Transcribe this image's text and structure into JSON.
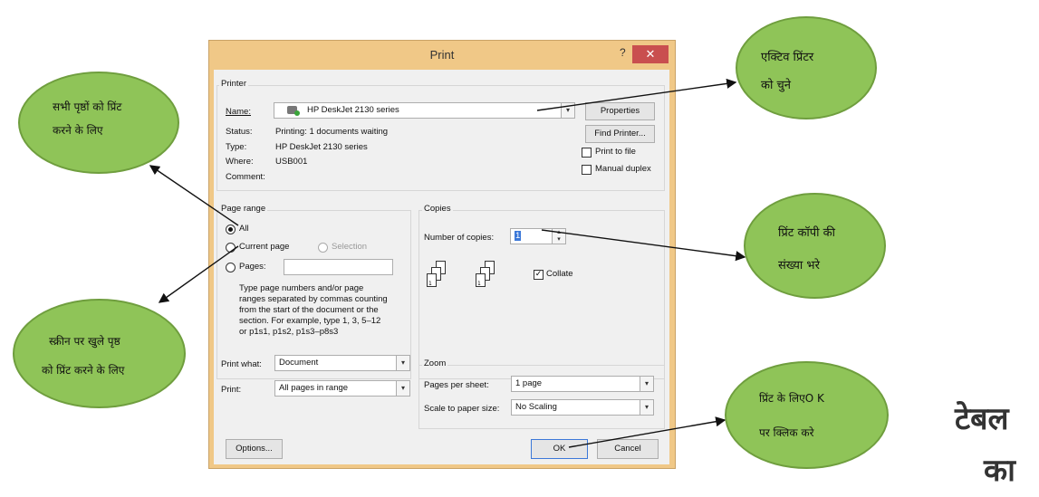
{
  "dialog": {
    "title": "Print",
    "help": "?",
    "close": "✕",
    "printer_group": "Printer",
    "name_label": "Name:",
    "printer_name": "HP DeskJet 2130 series",
    "properties": "Properties",
    "find_printer": "Find Printer...",
    "print_to_file": "Print to file",
    "manual_duplex": "Manual duplex",
    "status_label": "Status:",
    "status_value": "Printing: 1 documents waiting",
    "type_label": "Type:",
    "type_value": "HP DeskJet 2130 series",
    "where_label": "Where:",
    "where_value": "USB001",
    "comment_label": "Comment:",
    "page_range_group": "Page range",
    "all": "All",
    "current_page": "Current page",
    "selection": "Selection",
    "pages": "Pages:",
    "pages_help": [
      "Type page numbers and/or page",
      "ranges separated by commas counting",
      "from the start of the document or the",
      "section. For example, type 1, 3, 5–12",
      "or p1s1, p1s2, p1s3–p8s3"
    ],
    "copies_group": "Copies",
    "number_of_copies_label": "Number of copies:",
    "copies_value": "1",
    "collate": "Collate",
    "print_what_label": "Print what:",
    "print_what_value": "Document",
    "print_label": "Print:",
    "print_value": "All pages in range",
    "zoom_group": "Zoom",
    "pages_per_sheet_label": "Pages per sheet:",
    "pages_per_sheet_value": "1 page",
    "scale_label": "Scale to paper size:",
    "scale_value": "No Scaling",
    "options": "Options...",
    "ok": "OK",
    "cancel": "Cancel"
  },
  "callouts": {
    "printer": [
      "एक्टिव प्रिंटर",
      "को चुने"
    ],
    "all_pages": [
      "सभी पृष्ठों को प्रिंट",
      "करने के लिए"
    ],
    "copies": [
      "प्रिंट कॉपी की",
      "संख्या भरे"
    ],
    "current_page": [
      "स्क्रीन पर खुले पृष्ठ",
      "को प्रिंट करने के लिए"
    ],
    "ok": [
      "प्रिंट के लिएO K",
      "पर क्लिक करे"
    ]
  },
  "side_text": [
    "टेबल",
    "का"
  ],
  "colors": {
    "bubble": "#8fc458",
    "dialog_frame": "#f0c887",
    "close": "#c94f4f"
  }
}
